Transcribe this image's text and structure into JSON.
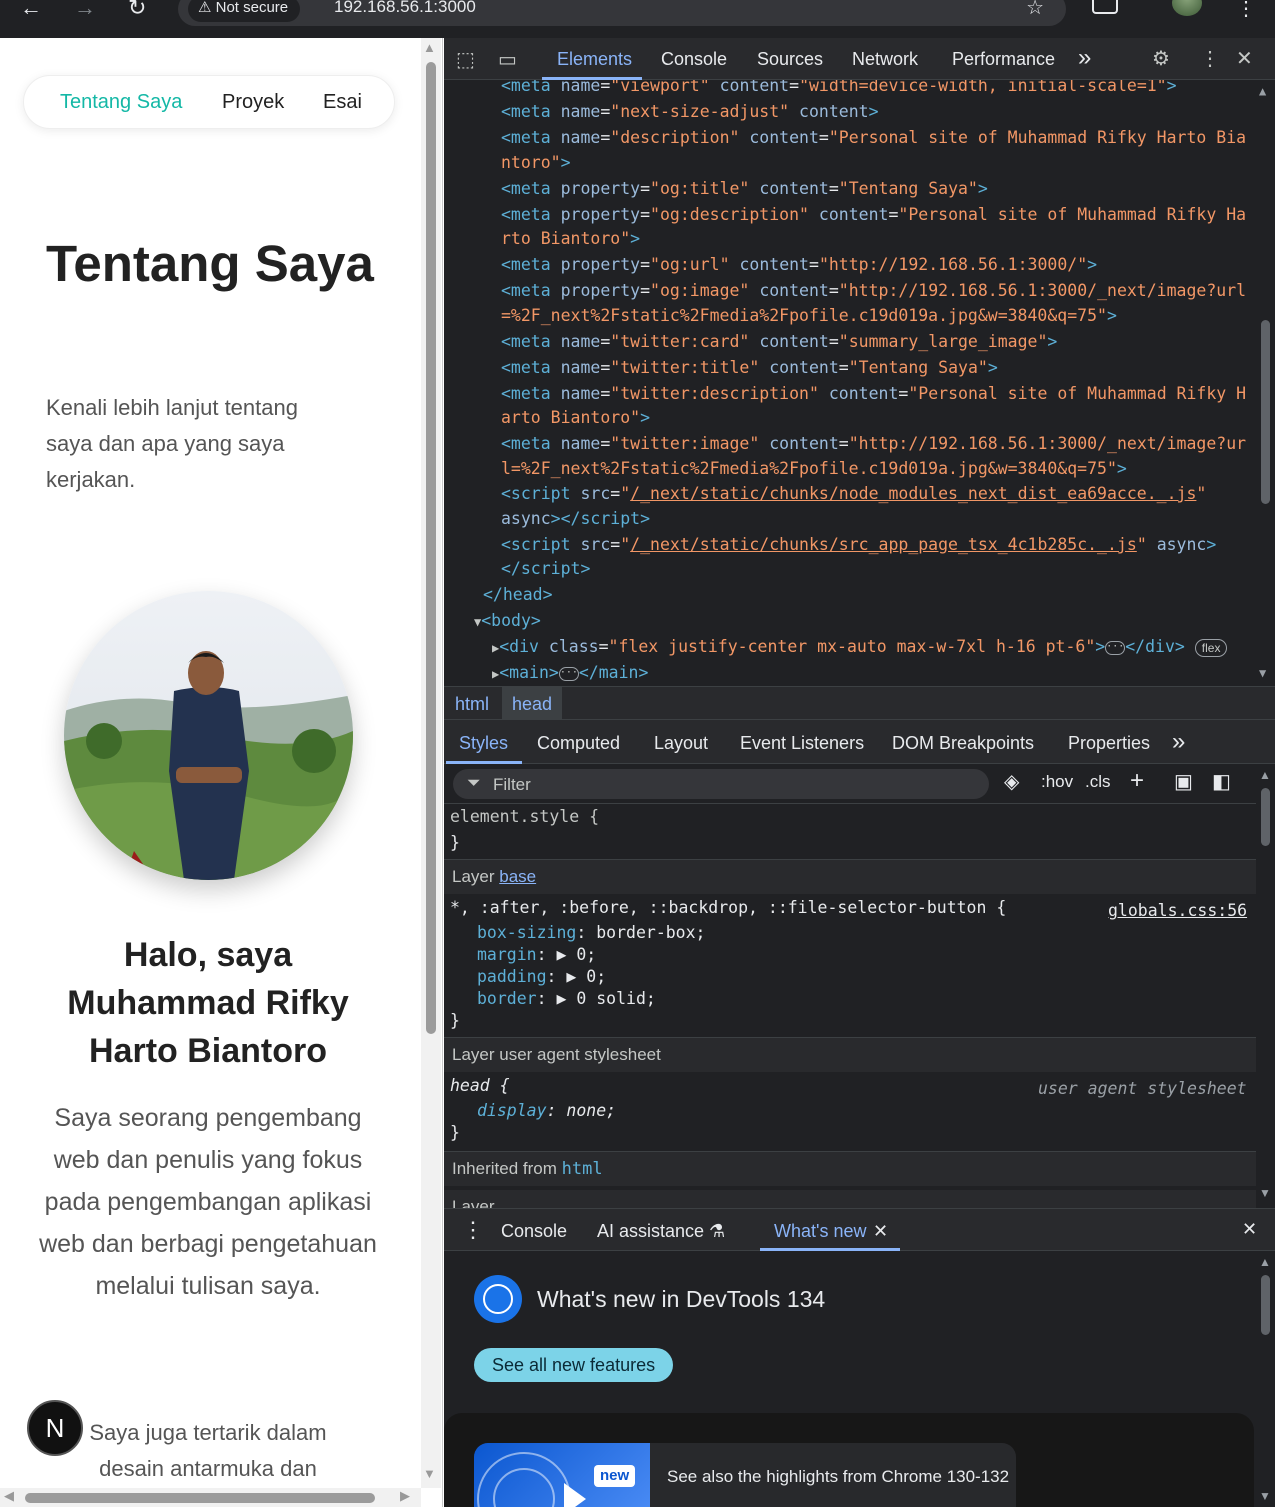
{
  "browser": {
    "not_secure": "⚠ Not secure",
    "url": "192.168.56.1:3000"
  },
  "page": {
    "nav": [
      "Tentang Saya",
      "Proyek",
      "Esai"
    ],
    "hero_title": "Tentang Saya",
    "hero_subtitle": "Kenali lebih lanjut tentang saya dan apa yang saya kerjakan.",
    "greeting": "Halo, saya Muhammad Rifky Harto Biantoro",
    "bio": "Saya seorang pengembang web dan penulis yang fokus pada pengembangan aplikasi web dan berbagi pengetahuan melalui tulisan saya.",
    "bio2": "Saya juga tertarik dalam desain antarmuka dan",
    "next_badge": "N",
    "accent_color": "#14b8a6"
  },
  "devtools": {
    "tabs": [
      "Elements",
      "Console",
      "Sources",
      "Network",
      "Performance"
    ],
    "more": "»",
    "breadcrumbs": [
      "html",
      "head"
    ],
    "styles_tabs": [
      "Styles",
      "Computed",
      "Layout",
      "Event Listeners",
      "DOM Breakpoints",
      "Properties"
    ],
    "filter_placeholder": "Filter",
    "hov": ":hov",
    "cls": ".cls",
    "rules": {
      "element_style": "element.style {",
      "close": "}",
      "layer_base_label": "Layer",
      "layer_base_link": "base",
      "universal_selector": "*, :after, :before, ::backdrop, ::file-selector-button {",
      "universal_source": "globals.css:56",
      "decls": [
        {
          "prop": "box-sizing",
          "value": " border-box;"
        },
        {
          "prop": "margin",
          "value": " ▶ 0;"
        },
        {
          "prop": "padding",
          "value": " ▶ 0;"
        },
        {
          "prop": "border",
          "value": " ▶ 0 solid;"
        }
      ],
      "layer_ua": "Layer user agent stylesheet",
      "head_selector": "head {",
      "ua_source": "user agent stylesheet",
      "head_decl_prop": "display",
      "head_decl_value": ": none;",
      "inherited_label": "Inherited from",
      "inherited_tag": "html",
      "layer_cut": "Layer"
    },
    "drawer": {
      "tabs": [
        "Console",
        "AI assistance",
        "What's new"
      ],
      "title": "What's new in DevTools 134",
      "button": "See all new features",
      "new_badge": "new",
      "highlight": "See also the highlights from Chrome 130-132"
    }
  }
}
